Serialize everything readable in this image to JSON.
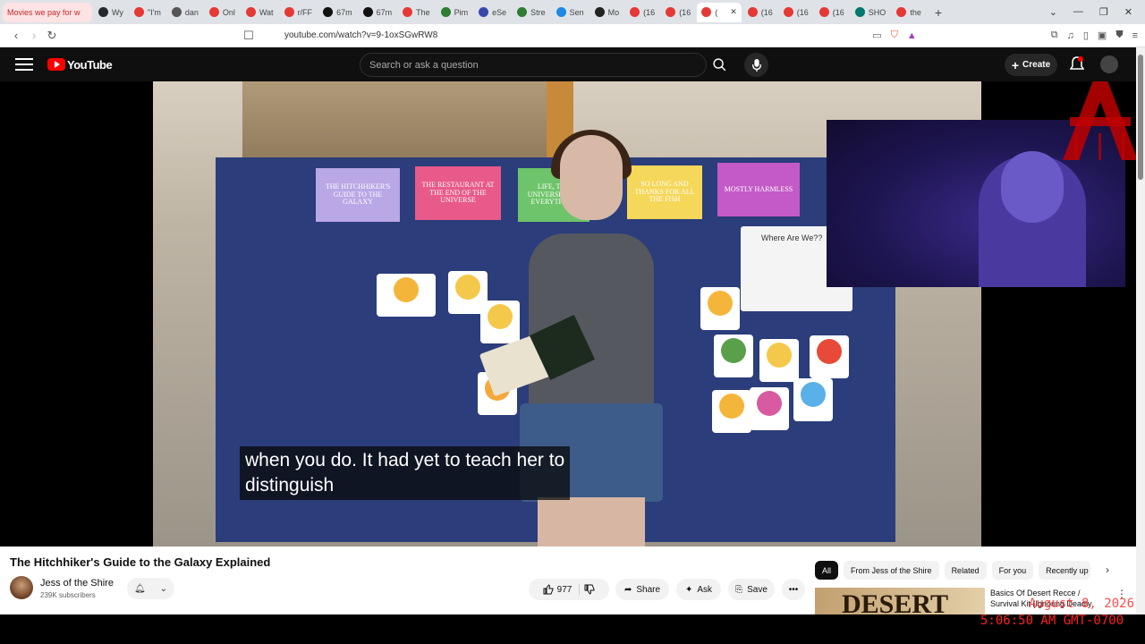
{
  "browser": {
    "tabs": [
      {
        "label": "Movies we pay for w",
        "color": "#e53935"
      },
      {
        "label": "Wy",
        "color": "#24292f"
      },
      {
        "label": "\"I'm",
        "color": "#e53935"
      },
      {
        "label": "dan",
        "color": "#555555"
      },
      {
        "label": "Onl",
        "color": "#e53935"
      },
      {
        "label": "Wat",
        "color": "#e53935"
      },
      {
        "label": "r/FF",
        "color": "#e53935"
      },
      {
        "label": "67m",
        "color": "#111111"
      },
      {
        "label": "67m",
        "color": "#111111"
      },
      {
        "label": "The",
        "color": "#e53935"
      },
      {
        "label": "Pim",
        "color": "#2e7d32"
      },
      {
        "label": "eSe",
        "color": "#3949ab"
      },
      {
        "label": "Stre",
        "color": "#2e7d32"
      },
      {
        "label": "Sen",
        "color": "#1e88e5"
      },
      {
        "label": "Mo",
        "color": "#222222"
      },
      {
        "label": "(16",
        "color": "#e53935"
      },
      {
        "label": "(16",
        "color": "#e53935"
      },
      {
        "label": "(",
        "color": "#e53935"
      },
      {
        "label": "(16",
        "color": "#e53935"
      },
      {
        "label": "(16",
        "color": "#e53935"
      },
      {
        "label": "(16",
        "color": "#e53935"
      },
      {
        "label": "SHO",
        "color": "#00796b"
      },
      {
        "label": "the",
        "color": "#e53935"
      }
    ],
    "url": "youtube.com/watch?v=9-1oxSGwRW8"
  },
  "header": {
    "logo": "YouTube",
    "search_placeholder": "Search or ask a question",
    "create_label": "Create"
  },
  "video": {
    "subtitle_line1": "when you do. It had yet to teach her to",
    "subtitle_line2": "distinguish",
    "cards": [
      {
        "text": "The Hitchhiker's Guide to the Galaxy",
        "color": "#b9a7e6"
      },
      {
        "text": "The Restaurant at the End of the Universe",
        "color": "#e85a8a"
      },
      {
        "text": "Life, the Universe and Everything",
        "color": "#6ec46a"
      },
      {
        "text": "So Long and Thanks for All the Fish",
        "color": "#f5d75a"
      },
      {
        "text": "Mostly Harmless",
        "color": "#c45ac8"
      }
    ],
    "whiteboard_text": "Where Are We??"
  },
  "info": {
    "title": "The Hitchhiker's Guide to the Galaxy Explained",
    "channel": "Jess of the Shire",
    "subscribers": "239K subscribers",
    "likes": "977",
    "share_label": "Share",
    "ask_label": "Ask",
    "save_label": "Save"
  },
  "sidebar": {
    "chips": [
      "All",
      "From Jess of the Shire",
      "Related",
      "For you",
      "Recently up"
    ],
    "rec_thumb_text": "DESERT",
    "rec_title": "Basics Of Desert Recce / Survival Kit (Ignoring Deadly"
  },
  "overlay": {
    "date": "August 8, 2026",
    "time": "5:06:50 AM GMT-0700"
  }
}
